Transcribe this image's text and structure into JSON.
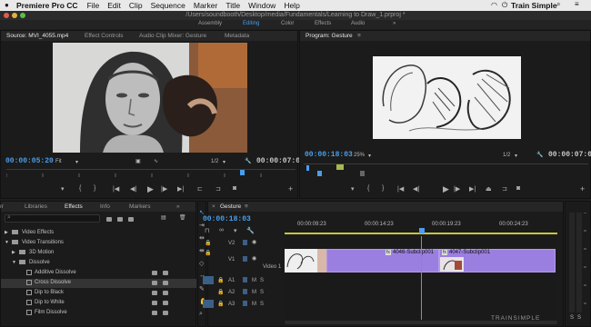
{
  "menubar": {
    "app": "Premiere Pro CC",
    "items": [
      "File",
      "Edit",
      "Clip",
      "Sequence",
      "Marker",
      "Title",
      "Window",
      "Help"
    ],
    "brand": "Train Simple"
  },
  "titlebar": {
    "path": "/Users/soundbooth/Desktop/media/Fundamentals/Learning to Draw_1.prproj *"
  },
  "workspaces": {
    "items": [
      "Assembly",
      "Editing",
      "Color",
      "Effects",
      "Audio"
    ],
    "more": "»",
    "active": "Editing"
  },
  "source": {
    "tabs": [
      "Source: MVI_4055.mp4",
      "Effect Controls",
      "Audio Clip Mixer: Gesture",
      "Metadata"
    ],
    "timecode": "00:00:05:20",
    "fit": "Fit",
    "resolution": "1/2",
    "duration": "00:00:07:03"
  },
  "program": {
    "tab": "Program: Gesture",
    "more": "≡",
    "timecode": "00:00:18:03",
    "zoom": "25%",
    "resolution": "1/2",
    "duration": "00:00:07:02"
  },
  "effects_panel": {
    "tabs": [
      "er",
      "Libraries",
      "Effects",
      "Info",
      "Markers"
    ],
    "more": "»",
    "search_placeholder": "",
    "tree": [
      {
        "label": "Video Effects",
        "indent": 0,
        "arrow": "▶"
      },
      {
        "label": "Video Transitions",
        "indent": 0,
        "arrow": "▼"
      },
      {
        "label": "3D Motion",
        "indent": 1,
        "arrow": "▶"
      },
      {
        "label": "Dissolve",
        "indent": 1,
        "arrow": "▼"
      },
      {
        "label": "Additive Dissolve",
        "indent": 2,
        "arrow": ""
      },
      {
        "label": "Cross Dissolve",
        "indent": 2,
        "arrow": "",
        "selected": true
      },
      {
        "label": "Dip to Black",
        "indent": 2,
        "arrow": ""
      },
      {
        "label": "Dip to White",
        "indent": 2,
        "arrow": ""
      },
      {
        "label": "Film Dissolve",
        "indent": 2,
        "arrow": ""
      }
    ]
  },
  "timeline": {
    "tab": "Gesture",
    "more": "≡",
    "timecode": "00:00:18:03",
    "ruler": [
      "00:00:09:23",
      "00:00:14:23",
      "00:00:19:23",
      "00:00:24:23"
    ],
    "video_tracks": [
      "V2",
      "V1",
      "Video 1"
    ],
    "audio_tracks": [
      "A1",
      "A2",
      "A3"
    ],
    "track_buttons": {
      "mute": "M",
      "solo": "S"
    },
    "clips": [
      "4046-Subclip001",
      "4047-Subclip001"
    ],
    "fx_badge": "fx"
  },
  "meter": {
    "labels": [
      "S",
      "S"
    ]
  },
  "watermark": "TRAINSIMPLE",
  "colors": {
    "accent": "#4a9eea",
    "clip": "#9b7fe0",
    "playhead": "#4a9eea"
  }
}
